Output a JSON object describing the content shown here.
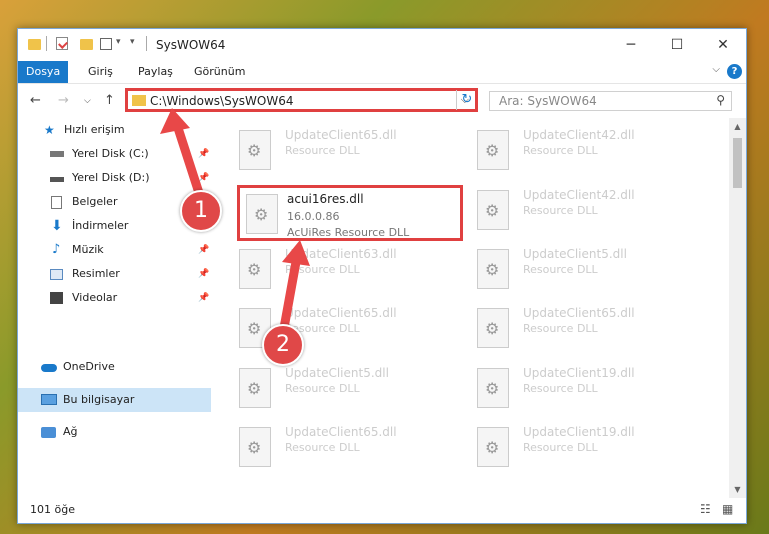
{
  "window": {
    "title": "SysWOW64"
  },
  "ribbon": {
    "tabs": [
      "Dosya",
      "Giriş",
      "Paylaş",
      "Görünüm"
    ],
    "help": "?"
  },
  "address": {
    "path": "C:\\Windows\\SysWOW64"
  },
  "search": {
    "placeholder": "Ara: SysWOW64"
  },
  "nav": {
    "items": [
      {
        "label": "Hızlı erişim",
        "icon": "star-icon"
      },
      {
        "label": "Yerel Disk (C:)",
        "icon": "drive-icon"
      },
      {
        "label": "Yerel Disk (D:)",
        "icon": "drive-icon"
      },
      {
        "label": "Belgeler",
        "icon": "documents-icon"
      },
      {
        "label": "İndirmeler",
        "icon": "download-icon"
      },
      {
        "label": "Müzik",
        "icon": "music-icon"
      },
      {
        "label": "Resimler",
        "icon": "pictures-icon"
      },
      {
        "label": "Videolar",
        "icon": "video-icon"
      },
      {
        "label": "OneDrive",
        "icon": "cloud-icon"
      },
      {
        "label": "Bu bilgisayar",
        "icon": "computer-icon"
      },
      {
        "label": "Ağ",
        "icon": "network-icon"
      }
    ]
  },
  "files": {
    "left": [
      {
        "name": "UpdateClient65.dll",
        "desc": "Resource DLL"
      },
      {
        "name": "UpdateClient63.dll",
        "desc": "Resource DLL"
      },
      {
        "name": "UpdateClient65.dll",
        "desc": "Resource DLL"
      },
      {
        "name": "UpdateClient5.dll",
        "desc": "Resource DLL"
      },
      {
        "name": "UpdateClient65.dll",
        "desc": "Resource DLL"
      }
    ],
    "right": [
      {
        "name": "UpdateClient42.dll",
        "desc": "Resource DLL"
      },
      {
        "name": "UpdateClient42.dll",
        "desc": "Resource DLL"
      },
      {
        "name": "UpdateClient5.dll",
        "desc": "Resource DLL"
      },
      {
        "name": "UpdateClient65.dll",
        "desc": "Resource DLL"
      },
      {
        "name": "UpdateClient19.dll",
        "desc": "Resource DLL"
      },
      {
        "name": "UpdateClient19.dll",
        "desc": "Resource DLL"
      }
    ],
    "highlight": {
      "name": "acui16res.dll",
      "version": "16.0.0.86",
      "desc": "AcUiRes Resource DLL"
    }
  },
  "status": {
    "count": "101 öğe"
  },
  "badges": [
    "1",
    "2"
  ],
  "colors": {
    "accent": "#1979ca",
    "highlight": "#e04040"
  }
}
